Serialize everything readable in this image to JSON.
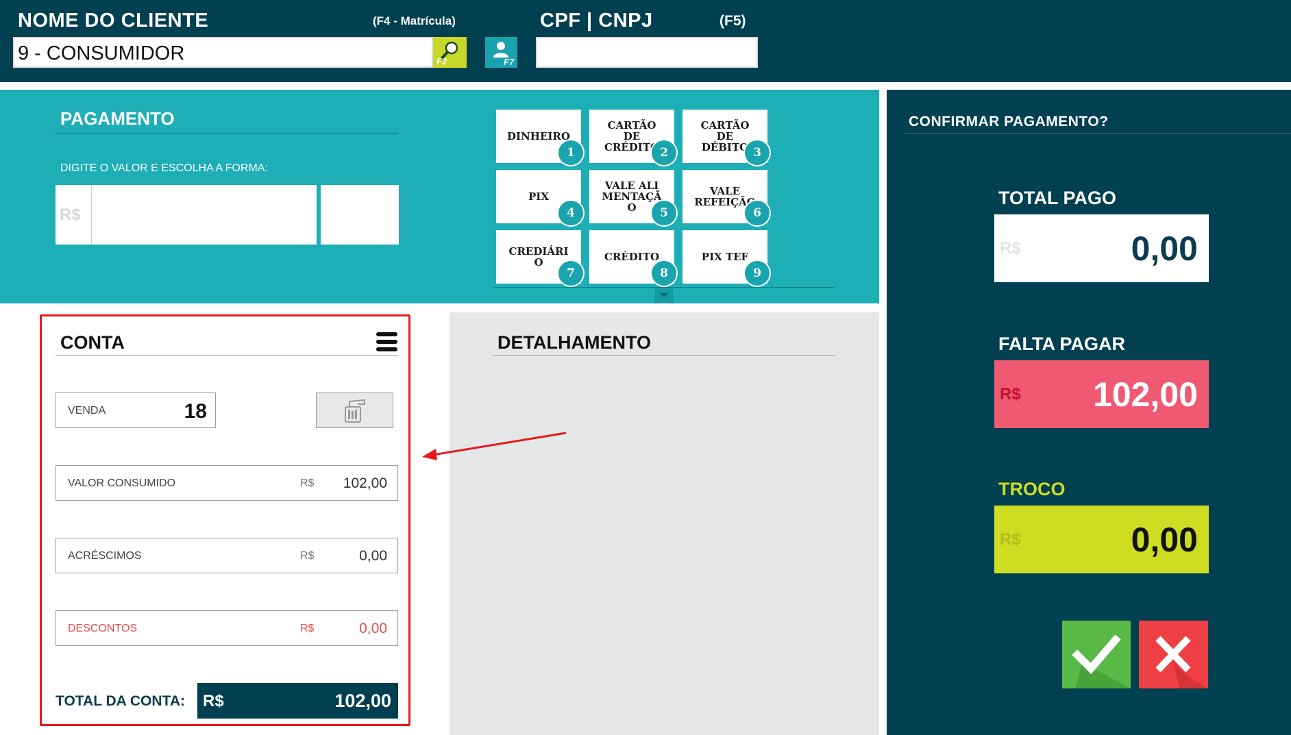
{
  "header": {
    "client_label": "NOME DO CLIENTE",
    "client_hint": "(F4 - Matrícula)",
    "client_value": "9 - CONSUMIDOR",
    "search_key": "F2",
    "person_key": "F7",
    "cpf_label": "CPF | CNPJ",
    "cpf_hint": "(F5)",
    "cpf_value": ""
  },
  "payment": {
    "title": "PAGAMENTO",
    "hint": "DIGITE O VALOR E ESCOLHA A FORMA:",
    "currency": "R$",
    "amount_value": "",
    "methods": [
      {
        "label": "DINHEIRO",
        "number": "1"
      },
      {
        "label": "CARTÃO DE CRÉDITO",
        "number": "2"
      },
      {
        "label": "CARTÃO DE DÉBITO",
        "number": "3"
      },
      {
        "label": "PIX",
        "number": "4"
      },
      {
        "label": "VALE ALIMENTAÇÃO",
        "number": "5"
      },
      {
        "label": "VALE REFEIÇÃO",
        "number": "6"
      },
      {
        "label": "CREDIÁRIO",
        "number": "7"
      },
      {
        "label": "CRÉDITO",
        "number": "8"
      },
      {
        "label": "PIX TEF",
        "number": "9"
      }
    ]
  },
  "conta": {
    "title": "CONTA",
    "venda_label": "VENDA",
    "venda_value": "18",
    "consumido_label": "VALOR CONSUMIDO",
    "consumido_currency": "R$",
    "consumido_value": "102,00",
    "acrescimos_label": "ACRÉSCIMOS",
    "acrescimos_currency": "R$",
    "acrescimos_value": "0,00",
    "descontos_label": "DESCONTOS",
    "descontos_currency": "R$",
    "descontos_value": "0,00",
    "total_label": "TOTAL DA CONTA:",
    "total_currency": "R$",
    "total_value": "102,00"
  },
  "detail": {
    "title": "DETALHAMENTO"
  },
  "summary": {
    "confirm_title": "CONFIRMAR PAGAMENTO?",
    "total_pago_label": "TOTAL PAGO",
    "total_pago_currency": "R$",
    "total_pago_value": "0,00",
    "falta_label": "FALTA PAGAR",
    "falta_currency": "R$",
    "falta_value": "102,00",
    "troco_label": "TROCO",
    "troco_currency": "R$",
    "troco_value": "0,00"
  },
  "colors": {
    "header_bg": "#004050",
    "payment_bg": "#1daeb6",
    "falta_bg": "#ef5a72",
    "troco_bg": "#cedd22",
    "confirm_green": "#5ab847",
    "cancel_red": "#ee3f45",
    "highlight_red": "#e8191c"
  },
  "icons": [
    "search-icon",
    "person-icon",
    "menu-icon",
    "waiter-icon",
    "check-icon",
    "close-icon",
    "chevron-down-icon",
    "arrow-annotation"
  ]
}
